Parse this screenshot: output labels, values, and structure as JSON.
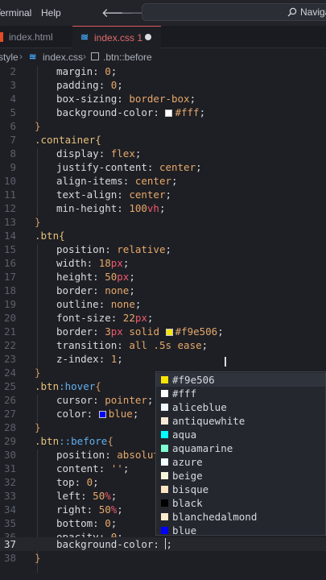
{
  "menubar": {
    "items": [
      "Terminal",
      "Help"
    ],
    "back_arrow": "🡐",
    "forward_arrow": "🡒",
    "search_placeholder": "Navigat"
  },
  "tabs": [
    {
      "label": "index.html",
      "icon": "html-file-icon",
      "active": false
    },
    {
      "label": "index.css 1",
      "icon": "css-file-icon",
      "active": true,
      "modified": true
    }
  ],
  "breadcrumb": [
    "style",
    "index.css",
    ".btn::before"
  ],
  "editor": {
    "current_line": 37,
    "lines": [
      {
        "n": "2"
      },
      {
        "n": "3"
      },
      {
        "n": "4"
      },
      {
        "n": "5"
      },
      {
        "n": "6"
      },
      {
        "n": "7"
      },
      {
        "n": "8"
      },
      {
        "n": "9"
      },
      {
        "n": "10"
      },
      {
        "n": "11"
      },
      {
        "n": "12"
      },
      {
        "n": "13"
      },
      {
        "n": "14"
      },
      {
        "n": "15"
      },
      {
        "n": "16"
      },
      {
        "n": "17"
      },
      {
        "n": "18"
      },
      {
        "n": "19"
      },
      {
        "n": "20"
      },
      {
        "n": "21"
      },
      {
        "n": "22"
      },
      {
        "n": "23"
      },
      {
        "n": "24"
      },
      {
        "n": "25"
      },
      {
        "n": "26"
      },
      {
        "n": "27"
      },
      {
        "n": "28"
      },
      {
        "n": "29"
      },
      {
        "n": "30"
      },
      {
        "n": "31"
      },
      {
        "n": "32"
      },
      {
        "n": "33"
      },
      {
        "n": "34"
      },
      {
        "n": "35"
      },
      {
        "n": "36"
      },
      {
        "n": "37"
      },
      {
        "n": "38"
      }
    ],
    "code": {
      "l2": {
        "p": "margin",
        "v": "0"
      },
      "l3": {
        "p": "padding",
        "v": "0"
      },
      "l4": {
        "p": "box-sizing",
        "v": "border-box"
      },
      "l5": {
        "p": "background-color",
        "v": "#fff",
        "swatch": "#ffffff"
      },
      "l6": "}",
      "l7": ".container{",
      "l8": {
        "p": "display",
        "v": "flex"
      },
      "l9": {
        "p": "justify-content",
        "v": "center"
      },
      "l10": {
        "p": "align-items",
        "v": "center"
      },
      "l11": {
        "p": "text-align",
        "v": "center"
      },
      "l12": {
        "p": "min-height",
        "v": "100",
        "u": "vh"
      },
      "l13": "}",
      "l14": ".btn{",
      "l15": {
        "p": "position",
        "v": "relative"
      },
      "l16": {
        "p": "width",
        "v": "18",
        "u": "px"
      },
      "l17": {
        "p": "height",
        "v": "50",
        "u": "px"
      },
      "l18": {
        "p": "border",
        "v": "none"
      },
      "l19": {
        "p": "outline",
        "v": "none"
      },
      "l20": {
        "p": "font-size",
        "v": "22",
        "u": "px"
      },
      "l21": {
        "p": "border",
        "v1": "3",
        "u1": "px",
        "v2": "solid",
        "v3": "#f9e506",
        "swatch": "#f9e506"
      },
      "l22": {
        "p": "transition",
        "v": "all .5s ease"
      },
      "l23": {
        "p": "z-index",
        "v": "1"
      },
      "l24": "}",
      "l25": {
        "sel": ".btn",
        "ps": ":hover",
        "brace": "{"
      },
      "l26": {
        "p": "cursor",
        "v": "pointer"
      },
      "l27": {
        "p": "color",
        "v": "blue",
        "swatch": "#0000ff"
      },
      "l28": "}",
      "l29": {
        "sel": ".btn",
        "ps": "::before",
        "brace": "{"
      },
      "l30": {
        "p": "position",
        "v": "absolute"
      },
      "l31": {
        "p": "content",
        "v": "''"
      },
      "l32": {
        "p": "top",
        "v": "0"
      },
      "l33": {
        "p": "left",
        "v": "50",
        "u": "%"
      },
      "l34": {
        "p": "right",
        "v": "50",
        "u": "%"
      },
      "l35": {
        "p": "bottom",
        "v": "0"
      },
      "l36": {
        "p": "opacity",
        "v": "0"
      },
      "l37": {
        "p": "background-color",
        "v": ";"
      },
      "l38": "}"
    }
  },
  "suggestions": [
    {
      "label": "#f9e506",
      "color": "#f9e506"
    },
    {
      "label": "#fff",
      "color": "#ffffff"
    },
    {
      "label": "aliceblue",
      "color": "#f0f8ff"
    },
    {
      "label": "antiquewhite",
      "color": "#faebd7"
    },
    {
      "label": "aqua",
      "color": "#00ffff"
    },
    {
      "label": "aquamarine",
      "color": "#7fffd4"
    },
    {
      "label": "azure",
      "color": "#f0ffff"
    },
    {
      "label": "beige",
      "color": "#f5f5dc"
    },
    {
      "label": "bisque",
      "color": "#ffe4c4"
    },
    {
      "label": "black",
      "color": "#000000"
    },
    {
      "label": "blanchedalmond",
      "color": "#ffebcd"
    },
    {
      "label": "blue",
      "color": "#0000ff"
    }
  ]
}
